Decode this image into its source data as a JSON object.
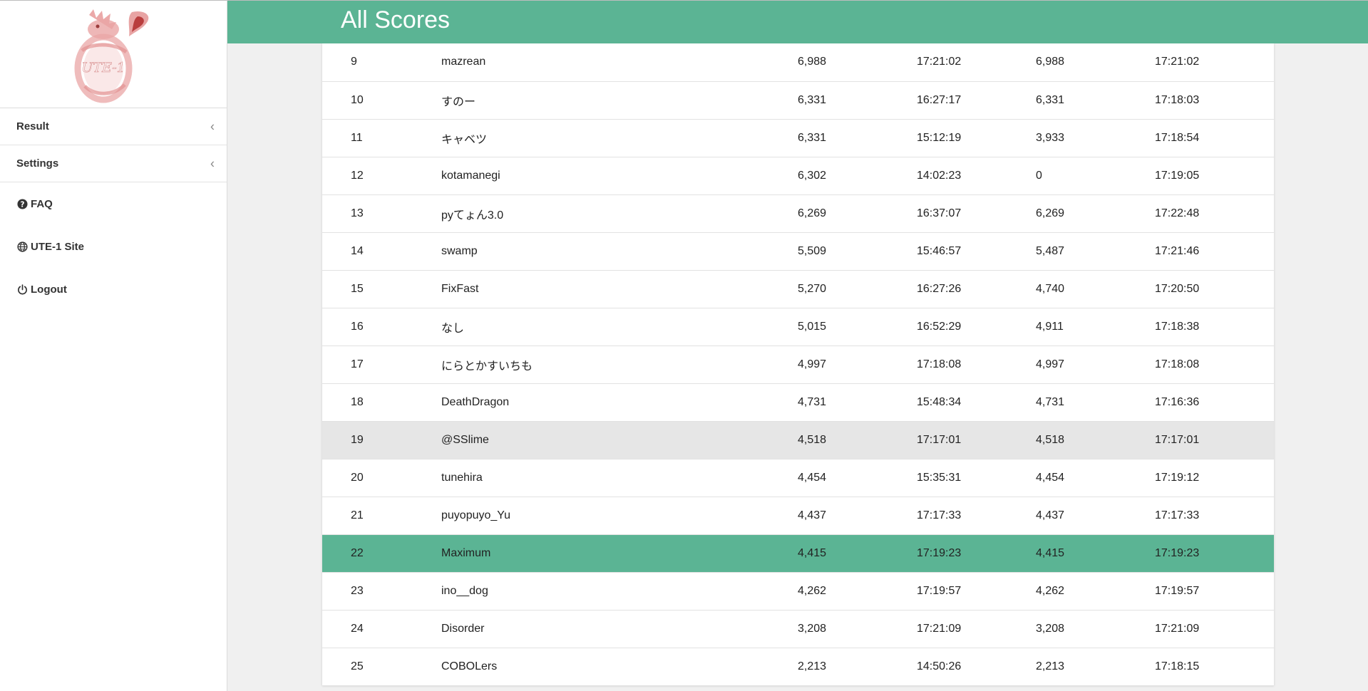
{
  "sidebar": {
    "logo_text": "UTE-1",
    "menu": [
      {
        "label": "Result",
        "chevron": "chevron-left-icon"
      },
      {
        "label": "Settings",
        "chevron": "chevron-left-icon"
      }
    ],
    "links": [
      {
        "label": "FAQ",
        "icon": "question-circle-icon"
      },
      {
        "label": "UTE-1 Site",
        "icon": "globe-icon"
      },
      {
        "label": "Logout",
        "icon": "power-icon"
      }
    ]
  },
  "header": {
    "title": "All Scores"
  },
  "colors": {
    "accent": "#5bb494",
    "hover_row": "#e6e6e6",
    "logo": "#e8a0a0"
  },
  "scores": {
    "rows": [
      {
        "rank": "9",
        "name": "mazrean",
        "score1": "6,988",
        "time1": "17:21:02",
        "score2": "6,988",
        "time2": "17:21:02"
      },
      {
        "rank": "10",
        "name": "すのー",
        "score1": "6,331",
        "time1": "16:27:17",
        "score2": "6,331",
        "time2": "17:18:03"
      },
      {
        "rank": "11",
        "name": "キャベツ",
        "score1": "6,331",
        "time1": "15:12:19",
        "score2": "3,933",
        "time2": "17:18:54"
      },
      {
        "rank": "12",
        "name": "kotamanegi",
        "score1": "6,302",
        "time1": "14:02:23",
        "score2": "0",
        "time2": "17:19:05"
      },
      {
        "rank": "13",
        "name": "pyてょん3.0",
        "score1": "6,269",
        "time1": "16:37:07",
        "score2": "6,269",
        "time2": "17:22:48"
      },
      {
        "rank": "14",
        "name": "swamp",
        "score1": "5,509",
        "time1": "15:46:57",
        "score2": "5,487",
        "time2": "17:21:46"
      },
      {
        "rank": "15",
        "name": "FixFast",
        "score1": "5,270",
        "time1": "16:27:26",
        "score2": "4,740",
        "time2": "17:20:50"
      },
      {
        "rank": "16",
        "name": "なし",
        "score1": "5,015",
        "time1": "16:52:29",
        "score2": "4,911",
        "time2": "17:18:38"
      },
      {
        "rank": "17",
        "name": "にらとかすいちも",
        "score1": "4,997",
        "time1": "17:18:08",
        "score2": "4,997",
        "time2": "17:18:08"
      },
      {
        "rank": "18",
        "name": "DeathDragon",
        "score1": "4,731",
        "time1": "15:48:34",
        "score2": "4,731",
        "time2": "17:16:36"
      },
      {
        "rank": "19",
        "name": "@SSlime",
        "score1": "4,518",
        "time1": "17:17:01",
        "score2": "4,518",
        "time2": "17:17:01"
      },
      {
        "rank": "20",
        "name": "tunehira",
        "score1": "4,454",
        "time1": "15:35:31",
        "score2": "4,454",
        "time2": "17:19:12"
      },
      {
        "rank": "21",
        "name": "puyopuyo_Yu",
        "score1": "4,437",
        "time1": "17:17:33",
        "score2": "4,437",
        "time2": "17:17:33"
      },
      {
        "rank": "22",
        "name": "Maximum",
        "score1": "4,415",
        "time1": "17:19:23",
        "score2": "4,415",
        "time2": "17:19:23"
      },
      {
        "rank": "23",
        "name": "ino__dog",
        "score1": "4,262",
        "time1": "17:19:57",
        "score2": "4,262",
        "time2": "17:19:57"
      },
      {
        "rank": "24",
        "name": "Disorder",
        "score1": "3,208",
        "time1": "17:21:09",
        "score2": "3,208",
        "time2": "17:21:09"
      },
      {
        "rank": "25",
        "name": "COBOLers",
        "score1": "2,213",
        "time1": "14:50:26",
        "score2": "2,213",
        "time2": "17:18:15"
      }
    ]
  }
}
